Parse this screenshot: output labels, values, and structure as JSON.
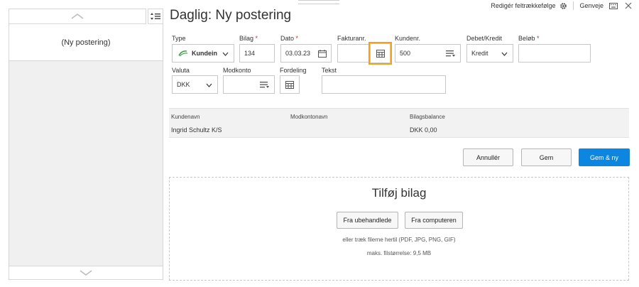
{
  "left_panel": {
    "sort_label": "⬍≡",
    "items": [
      {
        "label": "(Ny postering)"
      }
    ]
  },
  "header": {
    "title": "Daglig: Ny postering",
    "edit_order_label": "Redigér feltrækkefølge",
    "shortcuts_label": "Genveje",
    "gear_icon": "gear-icon",
    "keyboard_icon": "keyboard-icon",
    "close_icon": "close-icon"
  },
  "form": {
    "type": {
      "label": "Type",
      "value": "Kundeindbetaling",
      "display": "Kundein"
    },
    "bilag": {
      "label": "Bilag",
      "value": "134"
    },
    "dato": {
      "label": "Dato",
      "value": "03.03.23"
    },
    "fakturanr": {
      "label": "Fakturanr.",
      "value": ""
    },
    "kundenr": {
      "label": "Kundenr.",
      "value": "500"
    },
    "debet_kredit": {
      "label": "Debet/Kredit",
      "value": "Kredit"
    },
    "belob": {
      "label": "Beløb",
      "value": ""
    },
    "valuta": {
      "label": "Valuta",
      "value": "DKK"
    },
    "modkonto": {
      "label": "Modkonto",
      "value": ""
    },
    "fordeling": {
      "label": "Fordeling"
    },
    "tekst": {
      "label": "Tekst",
      "value": ""
    },
    "required_mark": "*"
  },
  "info": {
    "kundenavn_label": "Kundenavn",
    "kundenavn_value": "Ingrid Schultz K/S",
    "modkontonavn_label": "Modkontonavn",
    "modkontonavn_value": "",
    "bilagsbalance_label": "Bilagsbalance",
    "bilagsbalance_value": "DKK 0,00"
  },
  "actions": {
    "cancel": "Annullér",
    "save": "Gem",
    "save_new": "Gem & ny"
  },
  "attachments": {
    "title": "Tilføj bilag",
    "from_unprocessed": "Fra ubehandlede",
    "from_computer": "Fra computeren",
    "drag_hint": "eller træk filerne hertil (PDF, JPG, PNG, GIF)",
    "max_size": "maks. filstørrelse: 9,5 MB"
  },
  "colors": {
    "accent": "#0c86e0",
    "highlight": "#f2a01d",
    "required": "#c0392b",
    "type_icon": "#3aa14a"
  }
}
